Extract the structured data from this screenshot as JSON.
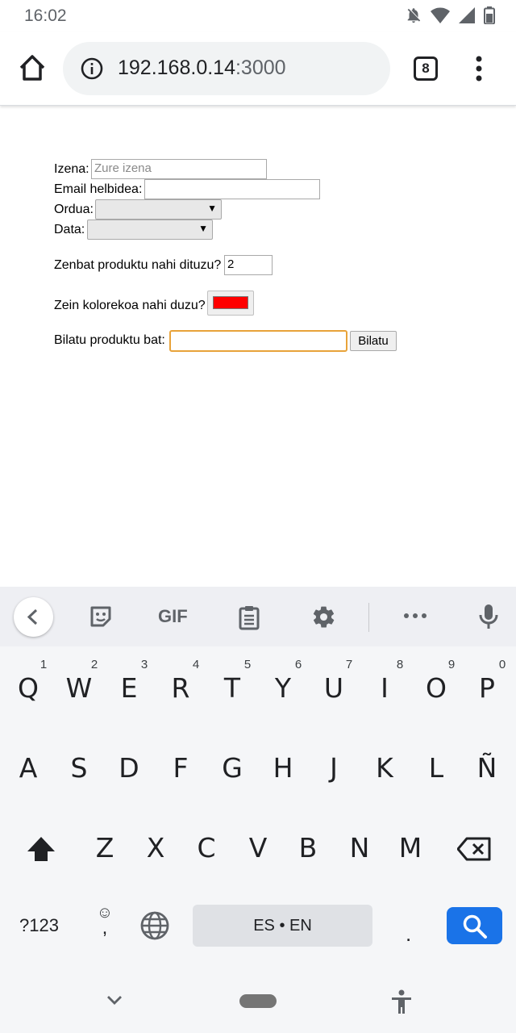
{
  "status_bar": {
    "time": "16:02",
    "icons": [
      "notifications-off-icon",
      "wifi-icon",
      "signal-icon",
      "battery-icon"
    ]
  },
  "browser": {
    "url_host": "192.168.0.14",
    "url_port": ":3000",
    "tab_count": "8"
  },
  "form": {
    "name_label": "Izena:",
    "name_placeholder": "Zure izena",
    "email_label": "Email helbidea:",
    "time_label": "Ordua:",
    "date_label": "Data:",
    "quantity_label": "Zenbat produktu nahi dituzu?",
    "quantity_value": "2",
    "color_label": "Zein kolorekoa nahi duzu?",
    "color_value": "#ff0000",
    "search_label": "Bilatu produktu bat:",
    "search_button": "Bilatu"
  },
  "keyboard": {
    "toolbar_icons": [
      "back-arrow-icon",
      "sticker-icon",
      "gif-icon",
      "clipboard-icon",
      "settings-icon",
      "more-icon",
      "microphone-icon"
    ],
    "gif_label": "GIF",
    "row1": [
      "Q",
      "W",
      "E",
      "R",
      "T",
      "Y",
      "U",
      "I",
      "O",
      "P"
    ],
    "row1_hints": [
      "1",
      "2",
      "3",
      "4",
      "5",
      "6",
      "7",
      "8",
      "9",
      "0"
    ],
    "row2": [
      "A",
      "S",
      "D",
      "F",
      "G",
      "H",
      "J",
      "K",
      "L",
      "Ñ"
    ],
    "row3": [
      "Z",
      "X",
      "C",
      "V",
      "B",
      "N",
      "M"
    ],
    "symbols_label": "?123",
    "comma_label": ",",
    "space_label": "ES • EN",
    "period_label": ".",
    "accent_color": "#1a73e8"
  }
}
